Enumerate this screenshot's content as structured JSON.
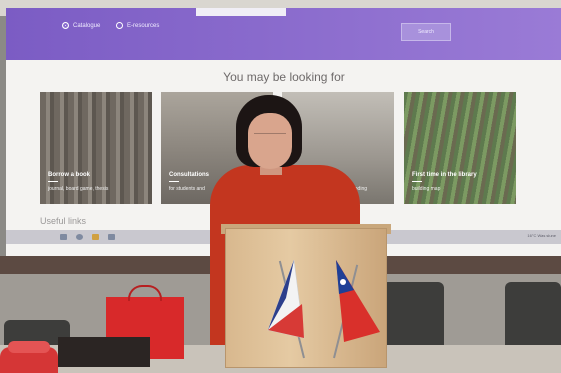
{
  "screen": {
    "radio_options": [
      {
        "label": "Catalogue",
        "selected": true
      },
      {
        "label": "E-resources",
        "selected": false
      }
    ],
    "search_button": "Search",
    "heading": "You may be looking for",
    "cards": [
      {
        "title": "Borrow a book",
        "subtitle": "journal, board game, thesis"
      },
      {
        "title": "Consultations",
        "subtitle": "for students and"
      },
      {
        "title": "",
        "subtitle": "ooding"
      },
      {
        "title": "First time in the library",
        "subtitle": "building map"
      }
    ],
    "more_label": "Useful links",
    "tray_text": "16°C  Was slune"
  },
  "colors": {
    "banner": "#8a6cd0",
    "dress": "#c3361f",
    "podium": "#dcbf98",
    "gift_bag": "#d8292a"
  },
  "scene": {
    "flags": [
      "czech-flag-icon",
      "taiwan-flag-icon"
    ]
  }
}
